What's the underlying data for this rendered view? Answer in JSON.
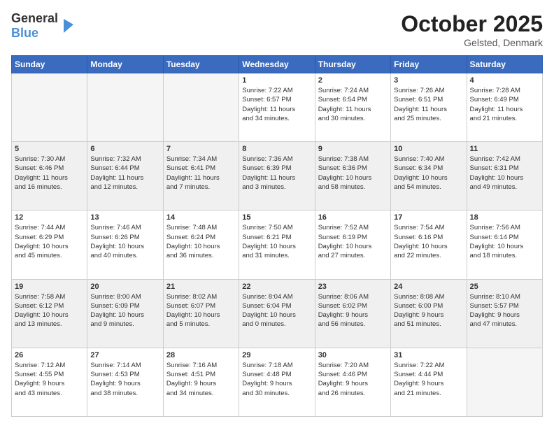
{
  "logo": {
    "general": "General",
    "blue": "Blue"
  },
  "header": {
    "month": "October 2025",
    "location": "Gelsted, Denmark"
  },
  "weekdays": [
    "Sunday",
    "Monday",
    "Tuesday",
    "Wednesday",
    "Thursday",
    "Friday",
    "Saturday"
  ],
  "weeks": [
    [
      {
        "day": "",
        "info": ""
      },
      {
        "day": "",
        "info": ""
      },
      {
        "day": "",
        "info": ""
      },
      {
        "day": "1",
        "info": "Sunrise: 7:22 AM\nSunset: 6:57 PM\nDaylight: 11 hours\nand 34 minutes."
      },
      {
        "day": "2",
        "info": "Sunrise: 7:24 AM\nSunset: 6:54 PM\nDaylight: 11 hours\nand 30 minutes."
      },
      {
        "day": "3",
        "info": "Sunrise: 7:26 AM\nSunset: 6:51 PM\nDaylight: 11 hours\nand 25 minutes."
      },
      {
        "day": "4",
        "info": "Sunrise: 7:28 AM\nSunset: 6:49 PM\nDaylight: 11 hours\nand 21 minutes."
      }
    ],
    [
      {
        "day": "5",
        "info": "Sunrise: 7:30 AM\nSunset: 6:46 PM\nDaylight: 11 hours\nand 16 minutes."
      },
      {
        "day": "6",
        "info": "Sunrise: 7:32 AM\nSunset: 6:44 PM\nDaylight: 11 hours\nand 12 minutes."
      },
      {
        "day": "7",
        "info": "Sunrise: 7:34 AM\nSunset: 6:41 PM\nDaylight: 11 hours\nand 7 minutes."
      },
      {
        "day": "8",
        "info": "Sunrise: 7:36 AM\nSunset: 6:39 PM\nDaylight: 11 hours\nand 3 minutes."
      },
      {
        "day": "9",
        "info": "Sunrise: 7:38 AM\nSunset: 6:36 PM\nDaylight: 10 hours\nand 58 minutes."
      },
      {
        "day": "10",
        "info": "Sunrise: 7:40 AM\nSunset: 6:34 PM\nDaylight: 10 hours\nand 54 minutes."
      },
      {
        "day": "11",
        "info": "Sunrise: 7:42 AM\nSunset: 6:31 PM\nDaylight: 10 hours\nand 49 minutes."
      }
    ],
    [
      {
        "day": "12",
        "info": "Sunrise: 7:44 AM\nSunset: 6:29 PM\nDaylight: 10 hours\nand 45 minutes."
      },
      {
        "day": "13",
        "info": "Sunrise: 7:46 AM\nSunset: 6:26 PM\nDaylight: 10 hours\nand 40 minutes."
      },
      {
        "day": "14",
        "info": "Sunrise: 7:48 AM\nSunset: 6:24 PM\nDaylight: 10 hours\nand 36 minutes."
      },
      {
        "day": "15",
        "info": "Sunrise: 7:50 AM\nSunset: 6:21 PM\nDaylight: 10 hours\nand 31 minutes."
      },
      {
        "day": "16",
        "info": "Sunrise: 7:52 AM\nSunset: 6:19 PM\nDaylight: 10 hours\nand 27 minutes."
      },
      {
        "day": "17",
        "info": "Sunrise: 7:54 AM\nSunset: 6:16 PM\nDaylight: 10 hours\nand 22 minutes."
      },
      {
        "day": "18",
        "info": "Sunrise: 7:56 AM\nSunset: 6:14 PM\nDaylight: 10 hours\nand 18 minutes."
      }
    ],
    [
      {
        "day": "19",
        "info": "Sunrise: 7:58 AM\nSunset: 6:12 PM\nDaylight: 10 hours\nand 13 minutes."
      },
      {
        "day": "20",
        "info": "Sunrise: 8:00 AM\nSunset: 6:09 PM\nDaylight: 10 hours\nand 9 minutes."
      },
      {
        "day": "21",
        "info": "Sunrise: 8:02 AM\nSunset: 6:07 PM\nDaylight: 10 hours\nand 5 minutes."
      },
      {
        "day": "22",
        "info": "Sunrise: 8:04 AM\nSunset: 6:04 PM\nDaylight: 10 hours\nand 0 minutes."
      },
      {
        "day": "23",
        "info": "Sunrise: 8:06 AM\nSunset: 6:02 PM\nDaylight: 9 hours\nand 56 minutes."
      },
      {
        "day": "24",
        "info": "Sunrise: 8:08 AM\nSunset: 6:00 PM\nDaylight: 9 hours\nand 51 minutes."
      },
      {
        "day": "25",
        "info": "Sunrise: 8:10 AM\nSunset: 5:57 PM\nDaylight: 9 hours\nand 47 minutes."
      }
    ],
    [
      {
        "day": "26",
        "info": "Sunrise: 7:12 AM\nSunset: 4:55 PM\nDaylight: 9 hours\nand 43 minutes."
      },
      {
        "day": "27",
        "info": "Sunrise: 7:14 AM\nSunset: 4:53 PM\nDaylight: 9 hours\nand 38 minutes."
      },
      {
        "day": "28",
        "info": "Sunrise: 7:16 AM\nSunset: 4:51 PM\nDaylight: 9 hours\nand 34 minutes."
      },
      {
        "day": "29",
        "info": "Sunrise: 7:18 AM\nSunset: 4:48 PM\nDaylight: 9 hours\nand 30 minutes."
      },
      {
        "day": "30",
        "info": "Sunrise: 7:20 AM\nSunset: 4:46 PM\nDaylight: 9 hours\nand 26 minutes."
      },
      {
        "day": "31",
        "info": "Sunrise: 7:22 AM\nSunset: 4:44 PM\nDaylight: 9 hours\nand 21 minutes."
      },
      {
        "day": "",
        "info": ""
      }
    ]
  ]
}
